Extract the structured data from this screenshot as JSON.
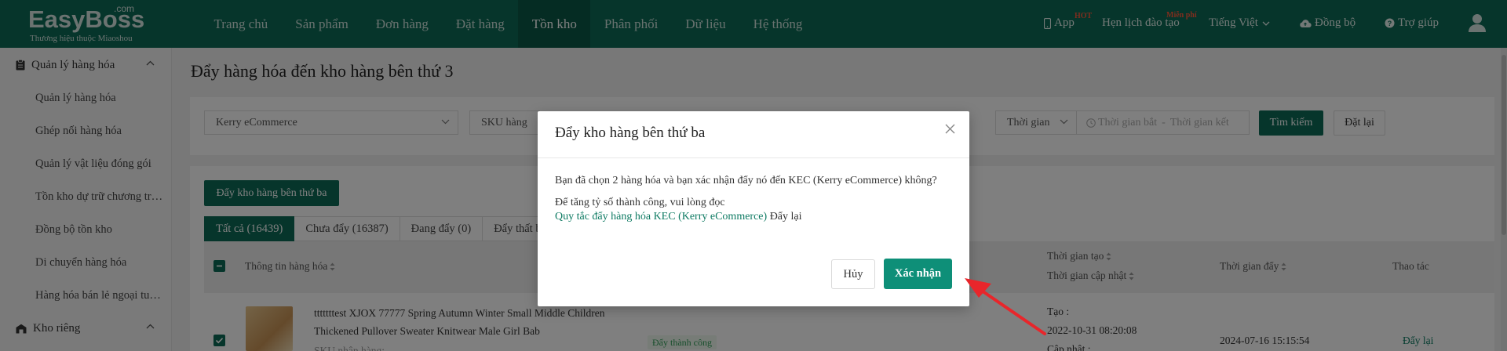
{
  "brand": {
    "name": "EasyBoss",
    "com": ".com",
    "tagline": "Thương hiệu thuộc Miaoshou"
  },
  "nav": [
    {
      "label": "Trang chủ",
      "active": false
    },
    {
      "label": "Sản phẩm",
      "active": false
    },
    {
      "label": "Đơn hàng",
      "active": false
    },
    {
      "label": "Đặt hàng",
      "active": false
    },
    {
      "label": "Tồn kho",
      "active": true
    },
    {
      "label": "Phân phối",
      "active": false
    },
    {
      "label": "Dữ liệu",
      "active": false
    },
    {
      "label": "Hệ thống",
      "active": false
    }
  ],
  "tools": {
    "app": "App",
    "app_badge": "HOT",
    "training": "Hẹn lịch đào tạo",
    "training_badge": "Miễn phí",
    "language": "Tiếng Việt",
    "sync": "Đồng bộ",
    "help": "Trợ giúp"
  },
  "sidebar": {
    "group1": "Quản lý hàng hóa",
    "items": [
      {
        "label": "Quản lý hàng hóa"
      },
      {
        "label": "Ghép nối hàng hóa"
      },
      {
        "label": "Quản lý vật liệu đóng gói"
      },
      {
        "label": "Tồn kho dự trữ chương trình"
      },
      {
        "label": "Đồng bộ tồn kho"
      },
      {
        "label": "Di chuyển hàng hóa"
      },
      {
        "label": "Hàng hóa bán lẻ ngoại tuyến"
      }
    ],
    "group2": "Kho riêng"
  },
  "page": {
    "title": "Đẩy hàng hóa đến kho hàng bên thứ 3"
  },
  "filters": {
    "warehouse": "Kerry eCommerce",
    "sku_type": "SKU hàng",
    "time_type": "Thời gian",
    "time_start_placeholder": "Thời gian bắt",
    "time_end_placeholder": "Thời gian kết",
    "search_btn": "Tìm kiếm",
    "reset_btn": "Đặt lại"
  },
  "list": {
    "push_btn": "Đẩy kho hàng bên thứ ba",
    "tabs": [
      {
        "label": "Tất cả (16439)",
        "active": true
      },
      {
        "label": "Chưa đẩy (16387)",
        "active": false
      },
      {
        "label": "Đang đẩy (0)",
        "active": false
      },
      {
        "label": "Đẩy thất bại",
        "active": false
      }
    ],
    "columns": {
      "product_info": "Thông tin hàng hóa",
      "created_time": "Thời gian tạo",
      "updated_time": "Thời gian cập nhật",
      "push_time": "Thời gian đẩy",
      "actions": "Thao tác"
    },
    "row": {
      "title_line1": "tttttttest XJOX 77777 Spring Autumn Winter Small Middle Children",
      "title_line2": "Thickened Pullover Sweater Knitwear Male Girl Bab",
      "sku_label": "SKU nhận hàng:",
      "status": "Đẩy thành công",
      "created_label": "Tạo :",
      "created_value": "2022-10-31 08:20:08",
      "updated_label": "Cập nhật :",
      "push_time": "2024-07-16 15:15:54",
      "action": "Đẩy lại"
    }
  },
  "modal": {
    "title": "Đẩy kho hàng bên thứ ba",
    "message": "Bạn đã chọn 2 hàng hóa và bạn xác nhận đẩy nó đến KEC (Kerry eCommerce) không?",
    "tip": "Để tăng tỷ số thành công, vui lòng đọc",
    "rule_link": "Quy tắc đẩy hàng hóa KEC (Kerry eCommerce)",
    "tip_suffix": "Đẩy lại",
    "cancel": "Hủy",
    "confirm": "Xác nhận"
  },
  "colors": {
    "brand_green": "#0d6b57",
    "confirm_green": "#0e8f78",
    "arrow_red": "#e8262b"
  }
}
